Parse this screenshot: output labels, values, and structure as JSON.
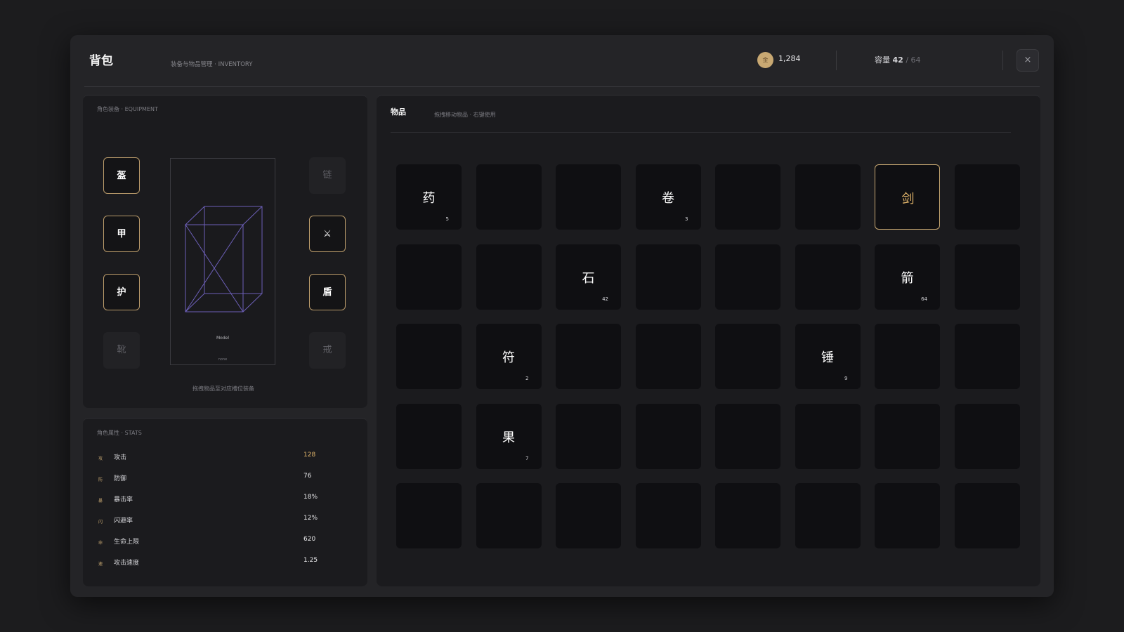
{
  "header": {
    "title": "背包",
    "subtitle": "装备与物品管理 · INVENTORY",
    "gold_icon_label": "金",
    "gold_amount": "1,284",
    "capacity_label": "容量",
    "capacity_used": "42",
    "capacity_sep": "/",
    "capacity_total": "64",
    "close_label": "×"
  },
  "equipment": {
    "label": "角色装备 · EQUIPMENT",
    "left_slots": [
      {
        "label": "盔",
        "filled": true
      },
      {
        "label": "甲",
        "filled": true
      },
      {
        "label": "护",
        "filled": true
      },
      {
        "label": "靴",
        "filled": false
      }
    ],
    "right_slots": [
      {
        "label": "链",
        "filled": false
      },
      {
        "label": "⚔",
        "filled": true
      },
      {
        "label": "盾",
        "filled": true
      },
      {
        "label": "戒",
        "filled": false
      }
    ],
    "model_name": "Model",
    "model_sub": "none",
    "hint": "拖拽物品至对应槽位装备"
  },
  "stats": {
    "label": "角色属性 · STATS",
    "rows": [
      {
        "icon": "攻",
        "name": "攻击",
        "value": "128",
        "highlight": true
      },
      {
        "icon": "防",
        "name": "防御",
        "value": "76",
        "highlight": false
      },
      {
        "icon": "暴",
        "name": "暴击率",
        "value": "18%",
        "highlight": false
      },
      {
        "icon": "闪",
        "name": "闪避率",
        "value": "12%",
        "highlight": false
      },
      {
        "icon": "命",
        "name": "生命上限",
        "value": "620",
        "highlight": false
      },
      {
        "icon": "速",
        "name": "攻击速度",
        "value": "1.25",
        "highlight": false
      }
    ]
  },
  "inventory": {
    "title": "物品",
    "hint": "拖拽移动物品 · 右键使用",
    "columns": 8,
    "cells": [
      {
        "glyph": "药",
        "count": "5"
      },
      {},
      {},
      {
        "glyph": "卷",
        "count": "3"
      },
      {},
      {},
      {
        "glyph": "剑",
        "selected": true
      },
      {},
      {},
      {},
      {
        "glyph": "石",
        "count": "42"
      },
      {},
      {},
      {},
      {
        "glyph": "箭",
        "count": "64"
      },
      {},
      {},
      {
        "glyph": "符",
        "count": "2"
      },
      {},
      {},
      {},
      {
        "glyph": "锤",
        "count": "9"
      },
      {},
      {},
      {},
      {
        "glyph": "果",
        "count": "7"
      },
      {},
      {},
      {},
      {},
      {},
      {},
      {},
      {},
      {},
      {},
      {},
      {},
      {},
      {}
    ]
  }
}
